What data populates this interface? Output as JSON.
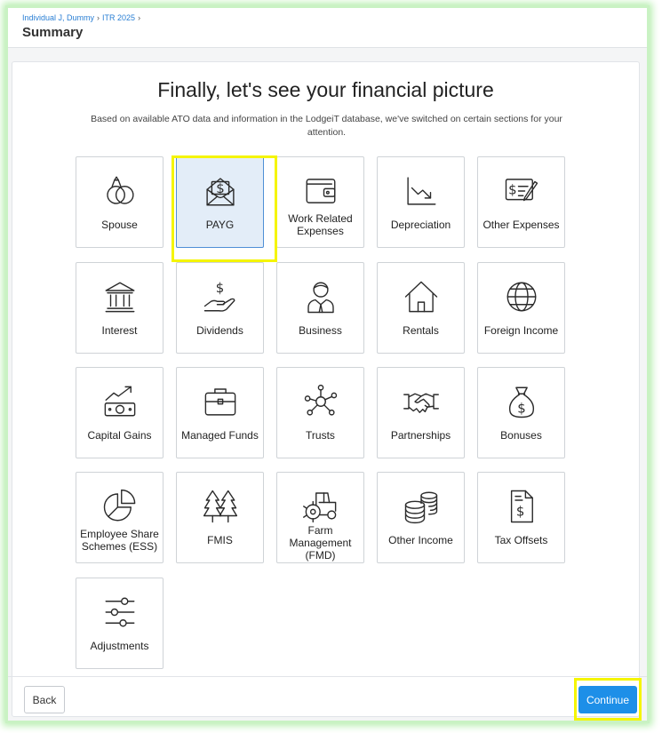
{
  "breadcrumb": {
    "items": [
      "Individual J, Dummy",
      "ITR 2025"
    ],
    "separator": "›"
  },
  "page": {
    "title": "Summary"
  },
  "main": {
    "heading": "Finally, let's see your financial picture",
    "subtitle": "Based on available ATO data and information in the LodgeiT database, we've switched on certain sections for your attention."
  },
  "tiles": [
    {
      "label": "Spouse",
      "icon": "rings-icon",
      "selected": false
    },
    {
      "label": "PAYG",
      "icon": "payslip-envelope-icon",
      "selected": true
    },
    {
      "label": "Work Related Expenses",
      "icon": "wallet-icon",
      "selected": false
    },
    {
      "label": "Depreciation",
      "icon": "declining-chart-icon",
      "selected": false
    },
    {
      "label": "Other Expenses",
      "icon": "bill-pen-icon",
      "selected": false
    },
    {
      "label": "Interest",
      "icon": "bank-icon",
      "selected": false
    },
    {
      "label": "Dividends",
      "icon": "hand-dollar-icon",
      "selected": false
    },
    {
      "label": "Business",
      "icon": "businessperson-icon",
      "selected": false
    },
    {
      "label": "Rentals",
      "icon": "house-icon",
      "selected": false
    },
    {
      "label": "Foreign Income",
      "icon": "globe-icon",
      "selected": false
    },
    {
      "label": "Capital Gains",
      "icon": "money-growth-icon",
      "selected": false
    },
    {
      "label": "Managed Funds",
      "icon": "briefcase-icon",
      "selected": false
    },
    {
      "label": "Trusts",
      "icon": "network-icon",
      "selected": false
    },
    {
      "label": "Partnerships",
      "icon": "handshake-icon",
      "selected": false
    },
    {
      "label": "Bonuses",
      "icon": "money-bag-icon",
      "selected": false
    },
    {
      "label": "Employee Share Schemes (ESS)",
      "icon": "pie-chart-icon",
      "selected": false
    },
    {
      "label": "FMIS",
      "icon": "trees-icon",
      "selected": false
    },
    {
      "label": "Farm Management (FMD)",
      "icon": "tractor-icon",
      "selected": false
    },
    {
      "label": "Other Income",
      "icon": "coins-stack-icon",
      "selected": false
    },
    {
      "label": "Tax Offsets",
      "icon": "tax-document-icon",
      "selected": false
    },
    {
      "label": "Adjustments",
      "icon": "sliders-icon",
      "selected": false
    }
  ],
  "footer": {
    "back_label": "Back",
    "continue_label": "Continue"
  },
  "colors": {
    "accent": "#1d8fe8",
    "highlight": "#f5f500",
    "selected_tile": "#e3edf8",
    "frame_glow": "#b9efb1"
  }
}
